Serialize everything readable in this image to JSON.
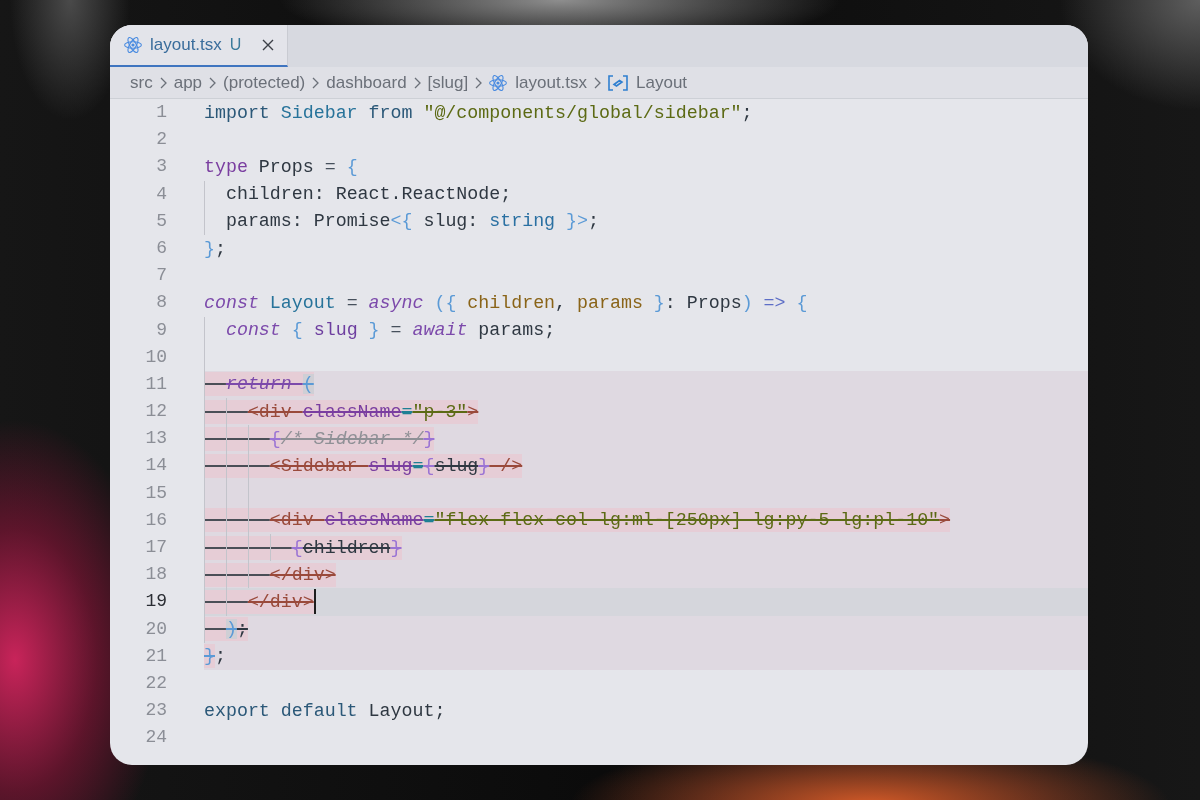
{
  "tabs": [
    {
      "label": "layout.tsx",
      "status": "U",
      "selected": true
    }
  ],
  "breadcrumb": [
    {
      "label": "src",
      "kind": "folder"
    },
    {
      "label": "app",
      "kind": "folder"
    },
    {
      "label": "(protected)",
      "kind": "folder"
    },
    {
      "label": "dashboard",
      "kind": "folder"
    },
    {
      "label": "[slug]",
      "kind": "folder"
    },
    {
      "label": "layout.tsx",
      "kind": "file"
    },
    {
      "label": "Layout",
      "kind": "symbol"
    }
  ],
  "editor": {
    "blocks": [
      {
        "kind": "normal",
        "lines": [
          {
            "number": "1",
            "cursor": false,
            "tokens": [
              {
                "text": "import ",
                "kind": "keyword"
              },
              {
                "text": "Sidebar ",
                "kind": "class"
              },
              {
                "text": "from ",
                "kind": "keyword"
              },
              {
                "text": "\"@/components/global/sidebar\"",
                "kind": "string"
              },
              {
                "text": ";",
                "kind": "plain"
              }
            ]
          },
          {
            "number": "2",
            "cursor": false
          },
          {
            "number": "3",
            "cursor": false,
            "tokens": [
              {
                "text": "type ",
                "kind": "storage"
              },
              {
                "text": "Props ",
                "kind": "plain"
              },
              {
                "text": "= ",
                "kind": "operator"
              },
              {
                "text": "{",
                "kind": "brace"
              }
            ]
          },
          {
            "number": "4",
            "cursor": false,
            "tokens": [
              {
                "text": "  children: React.ReactNode;",
                "kind": "plain"
              }
            ]
          },
          {
            "number": "5",
            "cursor": false,
            "tokens": [
              {
                "text": "  params: Promise",
                "kind": "plain"
              },
              {
                "text": "<{ ",
                "kind": "brace"
              },
              {
                "text": "slug: ",
                "kind": "plain"
              },
              {
                "text": "string ",
                "kind": "primitive"
              },
              {
                "text": "}>",
                "kind": "brace"
              },
              {
                "text": ";",
                "kind": "plain"
              }
            ]
          },
          {
            "number": "6",
            "cursor": false,
            "tokens": [
              {
                "text": "}",
                "kind": "brace"
              },
              {
                "text": ";",
                "kind": "plain"
              }
            ]
          },
          {
            "number": "7",
            "cursor": false
          },
          {
            "number": "8",
            "cursor": false,
            "tokens": [
              {
                "text": "const ",
                "kind": "control"
              },
              {
                "text": "Layout ",
                "kind": "class"
              },
              {
                "text": "= ",
                "kind": "operator"
              },
              {
                "text": "async ",
                "kind": "control"
              },
              {
                "text": "({ ",
                "kind": "brace"
              },
              {
                "text": "children",
                "kind": "parameter"
              },
              {
                "text": ", ",
                "kind": "plain"
              },
              {
                "text": "params ",
                "kind": "parameter"
              },
              {
                "text": "}",
                "kind": "brace"
              },
              {
                "text": ": Props",
                "kind": "plain"
              },
              {
                "text": ") ",
                "kind": "brace"
              },
              {
                "text": "=> ",
                "kind": "arrow"
              },
              {
                "text": "{",
                "kind": "brace"
              }
            ]
          },
          {
            "number": "9",
            "cursor": false,
            "tokens": [
              {
                "text": "  const ",
                "kind": "control"
              },
              {
                "text": "{ ",
                "kind": "brace"
              },
              {
                "text": "slug ",
                "kind": "variable"
              },
              {
                "text": "} ",
                "kind": "brace"
              },
              {
                "text": "= ",
                "kind": "operator"
              },
              {
                "text": "await ",
                "kind": "control"
              },
              {
                "text": "params;",
                "kind": "plain"
              }
            ]
          },
          {
            "number": "10",
            "cursor": false
          }
        ]
      },
      {
        "kind": "struck",
        "lines": [
          {
            "number": "11",
            "cursor": false,
            "struck": [
              {
                "text": "  return ",
                "kind": "control"
              },
              {
                "text": "(",
                "kind": "match"
              }
            ]
          },
          {
            "number": "12",
            "cursor": false,
            "struck": [
              {
                "text": "    <div ",
                "kind": "tag"
              },
              {
                "text": "className",
                "kind": "attribute"
              },
              {
                "text": "=",
                "kind": "equals"
              },
              {
                "text": "\"p-3\"",
                "kind": "string"
              },
              {
                "text": ">",
                "kind": "tag"
              }
            ]
          },
          {
            "number": "13",
            "cursor": false,
            "struck": [
              {
                "text": "      {",
                "kind": "embed"
              },
              {
                "text": "/* Sidebar */",
                "kind": "comment"
              },
              {
                "text": "}",
                "kind": "embed"
              }
            ]
          },
          {
            "number": "14",
            "cursor": false,
            "struck": [
              {
                "text": "      <Sidebar ",
                "kind": "tag"
              },
              {
                "text": "slug",
                "kind": "attribute"
              },
              {
                "text": "=",
                "kind": "equals"
              },
              {
                "text": "{",
                "kind": "embed"
              },
              {
                "text": "slug",
                "kind": "plain"
              },
              {
                "text": "}",
                "kind": "embed"
              },
              {
                "text": " />",
                "kind": "tag"
              }
            ]
          },
          {
            "number": "15",
            "cursor": false
          },
          {
            "number": "16",
            "cursor": false,
            "struck": [
              {
                "text": "      <div ",
                "kind": "tag"
              },
              {
                "text": "className",
                "kind": "attribute"
              },
              {
                "text": "=",
                "kind": "equals"
              },
              {
                "text": "\"flex flex-col lg:ml-[250px] lg:py-5 lg:pl-10\"",
                "kind": "string"
              },
              {
                "text": ">",
                "kind": "tag"
              }
            ]
          },
          {
            "number": "17",
            "cursor": false,
            "struck": [
              {
                "text": "        {",
                "kind": "embed"
              },
              {
                "text": "children",
                "kind": "plain"
              },
              {
                "text": "}",
                "kind": "embed"
              }
            ]
          },
          {
            "number": "18",
            "cursor": false,
            "struck": [
              {
                "text": "      </div>",
                "kind": "tag"
              }
            ]
          },
          {
            "number": "19",
            "cursor": true,
            "struck": [
              {
                "text": "    </div>",
                "kind": "tag"
              }
            ]
          },
          {
            "number": "20",
            "cursor": false,
            "struck": [
              {
                "text": "  )",
                "kind": "match"
              },
              {
                "text": ";",
                "kind": "plain"
              }
            ]
          },
          {
            "number": "21",
            "cursor": false,
            "struck": [
              {
                "text": "}",
                "kind": "brace"
              }
            ],
            "tokens": [
              {
                "text": ";",
                "kind": "plain"
              }
            ]
          }
        ]
      },
      {
        "kind": "normal",
        "lines": [
          {
            "number": "22",
            "cursor": false
          },
          {
            "number": "23",
            "cursor": false,
            "tokens": [
              {
                "text": "export default ",
                "kind": "keyword"
              },
              {
                "text": "Layout;",
                "kind": "plain"
              }
            ]
          },
          {
            "number": "24",
            "cursor": false
          }
        ]
      }
    ]
  }
}
